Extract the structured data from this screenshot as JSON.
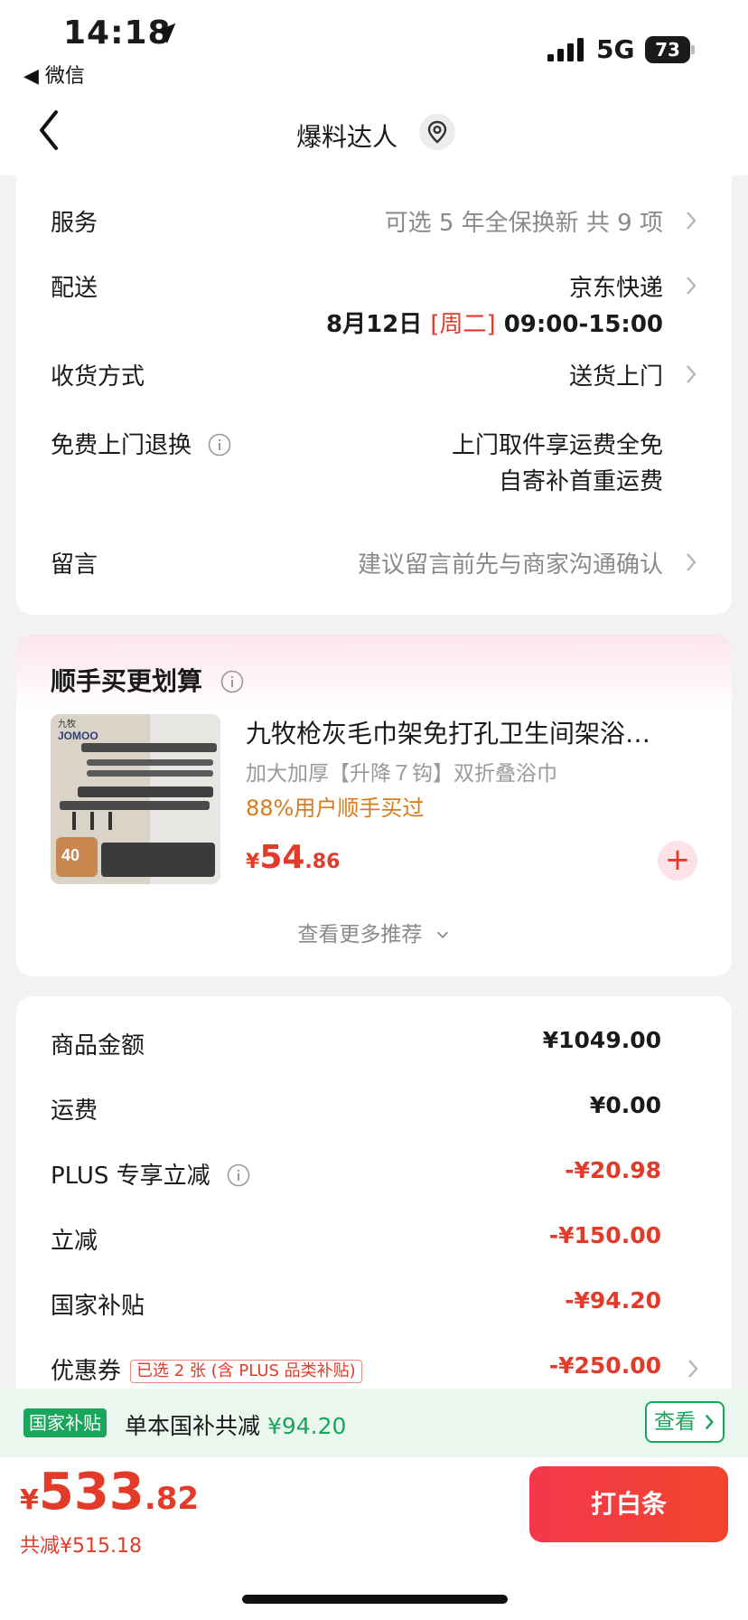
{
  "status": {
    "time": "14:18",
    "back_app": "◀ 微信",
    "network": "5G",
    "battery": "73"
  },
  "nav": {
    "title": "爆料达人"
  },
  "details": {
    "service": {
      "label": "服务",
      "value": "可选 5 年全保换新 共 9 项"
    },
    "delivery": {
      "label": "配送",
      "value": "京东快递",
      "date": "8月12日",
      "weekday": "[周二]",
      "time_range": "09:00-15:00"
    },
    "receive": {
      "label": "收货方式",
      "value": "送货上门"
    },
    "return": {
      "label": "免费上门退换",
      "line1": "上门取件享运费全免",
      "line2": "自寄补首重运费"
    },
    "note": {
      "label": "留言",
      "placeholder": "建议留言前先与商家沟通确认"
    }
  },
  "addon": {
    "title": "顺手买更划算",
    "product": {
      "name": "九牧枪灰毛巾架免打孔卫生间架浴…",
      "sub": "加大加厚【升降７钩】双折叠浴巾",
      "buyers": "88%用户顺手买过",
      "price_currency": "¥",
      "price_int": "54",
      "price_dec": ".86",
      "add": "+"
    },
    "more": "查看更多推荐"
  },
  "summary": {
    "goods": {
      "label": "商品金额",
      "value": "¥1049.00"
    },
    "shipping": {
      "label": "运费",
      "value": "¥0.00"
    },
    "plus": {
      "label": "PLUS 专享立减",
      "value": "-¥20.98"
    },
    "instant": {
      "label": "立减",
      "value": "-¥150.00"
    },
    "national": {
      "label": "国家补贴",
      "value": "-¥94.20"
    },
    "coupon": {
      "label": "优惠券",
      "tag": "已选 2 张 (含 PLUS 品类补贴)",
      "value": "-¥250.00"
    }
  },
  "subsidy": {
    "badge": "国家补贴",
    "text": "单本国补共减",
    "amount": "¥94.20",
    "view": "查看"
  },
  "checkout": {
    "currency": "¥",
    "total_int": "533",
    "total_dec": ".82",
    "saved": "共减¥515.18",
    "pay": "打白条"
  },
  "colors": {
    "accent_red": "#e23b2a",
    "green": "#18a65b",
    "orange": "#d97a1c"
  }
}
